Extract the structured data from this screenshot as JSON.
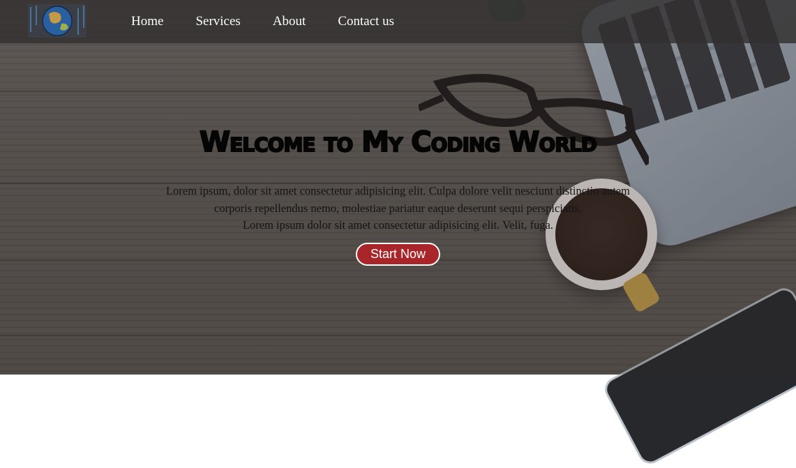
{
  "nav": {
    "logo_icon": "globe-icon",
    "links": [
      "Home",
      "Services",
      "About",
      "Contact us"
    ]
  },
  "hero": {
    "title": "Welcome to My Coding World",
    "paragraph_line1": "Lorem ipsum, dolor sit amet consectetur adipisicing elit. Culpa dolore velit nesciunt distinctio autem corporis repellendus nemo, molestiae pariatur eaque deserunt sequi perspiciatis.",
    "paragraph_line2": "Lorem ipsum dolor sit amet consectetur adipisicing elit. Velit, fuga.",
    "button_label": "Start Now"
  },
  "colors": {
    "accent": "#a8262a",
    "nav_background": "#323030"
  }
}
